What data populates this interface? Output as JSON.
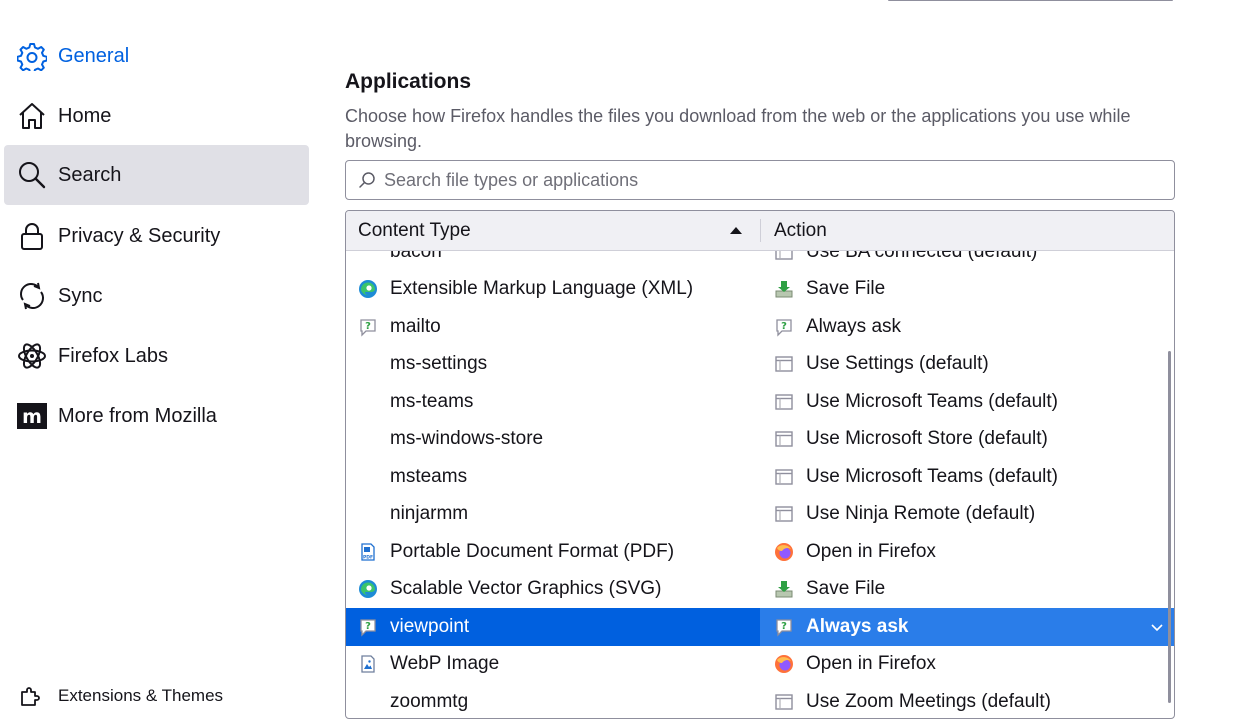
{
  "sidebar": {
    "items": [
      {
        "label": "General",
        "icon": "gear-icon"
      },
      {
        "label": "Home",
        "icon": "home-icon"
      },
      {
        "label": "Search",
        "icon": "search-icon"
      },
      {
        "label": "Privacy & Security",
        "icon": "lock-icon"
      },
      {
        "label": "Sync",
        "icon": "sync-icon"
      },
      {
        "label": "Firefox Labs",
        "icon": "atom-icon"
      },
      {
        "label": "More from Mozilla",
        "icon": "mozilla-icon"
      }
    ],
    "footer": {
      "label": "Extensions & Themes",
      "icon": "puzzle-icon"
    }
  },
  "applications": {
    "heading": "Applications",
    "description": "Choose how Firefox handles the files you download from the web or the applications you use while browsing.",
    "search_placeholder": "Search file types or applications",
    "columns": {
      "content_type": "Content Type",
      "action": "Action"
    },
    "rows": [
      {
        "type": "bacon",
        "type_icon": "",
        "action": "Use BA connected (default)",
        "action_icon": "app-icon"
      },
      {
        "type": "Extensible Markup Language (XML)",
        "type_icon": "edge-icon",
        "action": "Save File",
        "action_icon": "save-file-icon"
      },
      {
        "type": "mailto",
        "type_icon": "ask-icon",
        "action": "Always ask",
        "action_icon": "ask-icon"
      },
      {
        "type": "ms-settings",
        "type_icon": "",
        "action": "Use Settings (default)",
        "action_icon": "app-icon"
      },
      {
        "type": "ms-teams",
        "type_icon": "",
        "action": "Use Microsoft Teams (default)",
        "action_icon": "app-icon"
      },
      {
        "type": "ms-windows-store",
        "type_icon": "",
        "action": "Use Microsoft Store (default)",
        "action_icon": "app-icon"
      },
      {
        "type": "msteams",
        "type_icon": "",
        "action": "Use Microsoft Teams (default)",
        "action_icon": "app-icon"
      },
      {
        "type": "ninjarmm",
        "type_icon": "",
        "action": "Use Ninja Remote (default)",
        "action_icon": "app-icon"
      },
      {
        "type": "Portable Document Format (PDF)",
        "type_icon": "pdf-icon",
        "action": "Open in Firefox",
        "action_icon": "firefox-icon"
      },
      {
        "type": "Scalable Vector Graphics (SVG)",
        "type_icon": "edge-icon",
        "action": "Save File",
        "action_icon": "save-file-icon"
      },
      {
        "type": "viewpoint",
        "type_icon": "ask-icon",
        "action": "Always ask",
        "action_icon": "ask-icon",
        "selected": true
      },
      {
        "type": "WebP Image",
        "type_icon": "image-file-icon",
        "action": "Open in Firefox",
        "action_icon": "firefox-icon"
      },
      {
        "type": "zoommtg",
        "type_icon": "",
        "action": "Use Zoom Meetings (default)",
        "action_icon": "app-icon"
      }
    ]
  },
  "colors": {
    "accent": "#0061e0",
    "selected_row": "#0060df",
    "selected_action": "#2a7de9",
    "sidebar_selected": "#e0e0e6"
  }
}
